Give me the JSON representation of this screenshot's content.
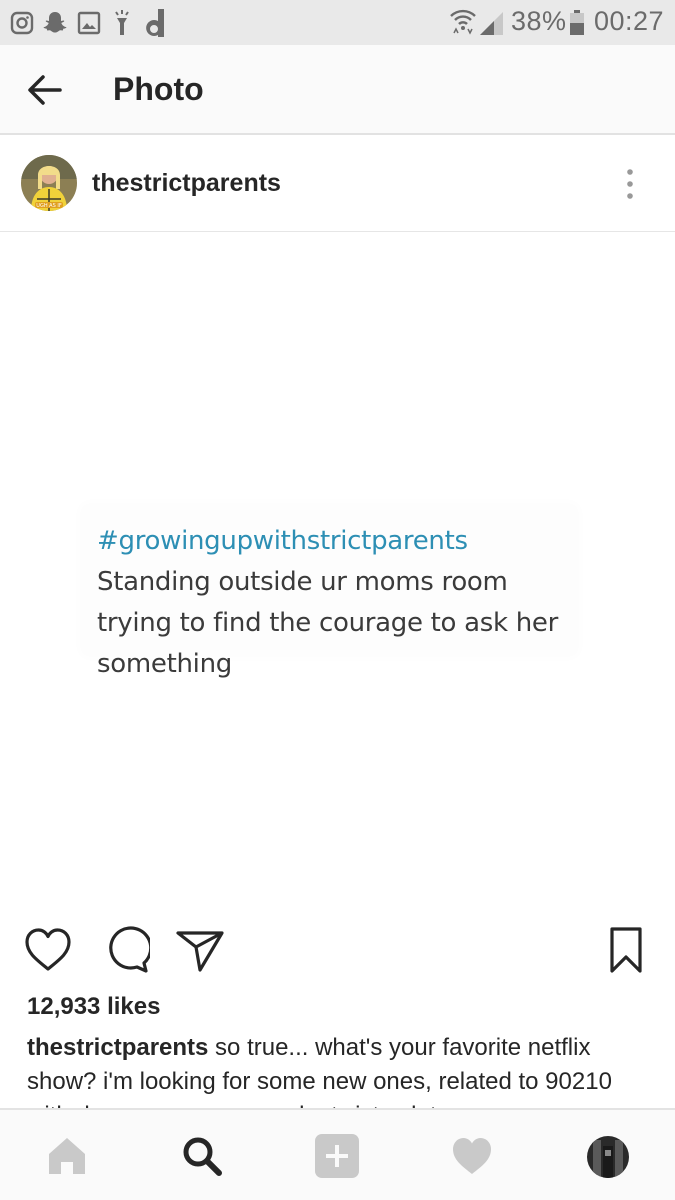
{
  "status_bar": {
    "notifications": [
      "instagram-icon",
      "snapchat-icon",
      "gallery-icon",
      "flashlight-icon",
      "dailyhunt-icon"
    ],
    "battery": "38%",
    "time": "00:27"
  },
  "header": {
    "title": "Photo",
    "back_icon": "back-arrow-icon"
  },
  "post": {
    "username": "thestrictparents",
    "image": {
      "hashtag": "#growingupwithstrictparents",
      "text": " Standing outside ur moms room trying to find the courage to ask her something"
    },
    "likes": "12,933 likes",
    "caption_user": "thestrictparents",
    "caption_text": " so true... what's your favorite netflix show? i'm looking for some new ones, related to 90210 with drama, romance, and a twisty plot"
  },
  "actions": [
    "heart-icon",
    "comment-icon",
    "share-icon",
    "bookmark-icon"
  ],
  "bottom_nav": [
    "home-icon",
    "search-icon",
    "add-icon",
    "activity-icon",
    "profile-icon"
  ],
  "colors": {
    "hashtag": "#2d8fb4",
    "text": "#262626",
    "status_bar": "#e9e9e9"
  }
}
